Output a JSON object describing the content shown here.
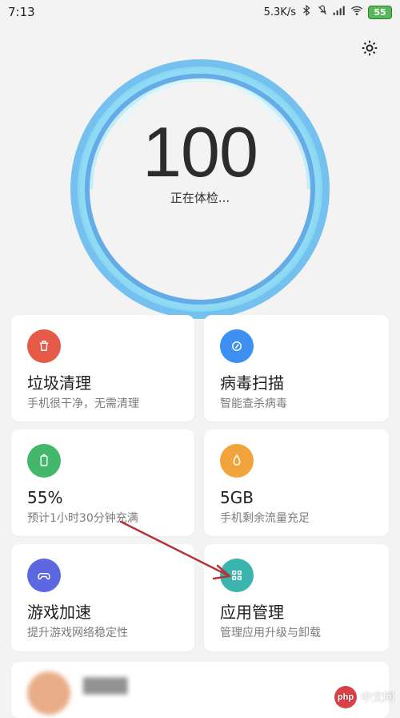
{
  "status_bar": {
    "time": "7:13",
    "speed": "5.3K/s",
    "battery": "55"
  },
  "score": {
    "value": "100",
    "status": "正在体检..."
  },
  "cards": [
    {
      "title": "垃圾清理",
      "subtitle": "手机很干净，无需清理",
      "icon": "trash-icon",
      "color": "#e55b48"
    },
    {
      "title": "病毒扫描",
      "subtitle": "智能查杀病毒",
      "icon": "shield-check-icon",
      "color": "#3d8ff3"
    },
    {
      "title": "55%",
      "subtitle": "预计1小时30分钟充满",
      "icon": "battery-icon",
      "color": "#44b86a"
    },
    {
      "title": "5GB",
      "subtitle": "手机剩余流量充足",
      "icon": "drop-icon",
      "color": "#f1a43c"
    },
    {
      "title": "游戏加速",
      "subtitle": "提升游戏网络稳定性",
      "icon": "gamepad-icon",
      "color": "#5d67df"
    },
    {
      "title": "应用管理",
      "subtitle": "管理应用升级与卸载",
      "icon": "grid-icon",
      "color": "#3cb4ae"
    }
  ],
  "watermark": {
    "badge": "php",
    "text": "中文网"
  }
}
